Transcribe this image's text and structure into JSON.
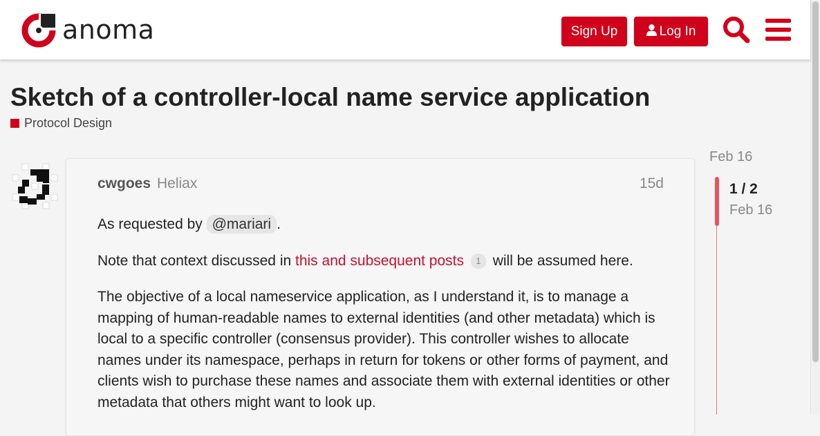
{
  "header": {
    "brand": "anoma",
    "signup_label": "Sign Up",
    "login_label": "Log In",
    "icons": [
      "anoma-logo",
      "user-icon",
      "search-icon",
      "menu-icon"
    ],
    "accent_color": "#d0021b"
  },
  "topic": {
    "title": "Sketch of a controller-local name service application",
    "category": "Protocol Design",
    "category_color": "#d0021b"
  },
  "post": {
    "username": "cwgoes",
    "user_title": "Heliax",
    "date": "15d",
    "para1_before": "As requested by ",
    "mention": "@mariari",
    "para1_after": ".",
    "para2_before": "Note that context discussed in ",
    "para2_link": "this and subsequent posts",
    "para2_link_count": "1",
    "para2_after": " will be assumed here.",
    "para3": "The objective of a local nameservice application, as I understand it, is to manage a mapping of human-readable names to external identities (and other metadata) which is local to a specific controller (consensus provider). This controller wishes to allocate names under its namespace, perhaps in return for tokens or other forms of payment, and clients wish to purchase these names and associate them with external identities or other metadata that others might want to look up."
  },
  "timeline": {
    "start_date": "Feb 16",
    "position": "1 / 2",
    "current_date": "Feb 16"
  }
}
